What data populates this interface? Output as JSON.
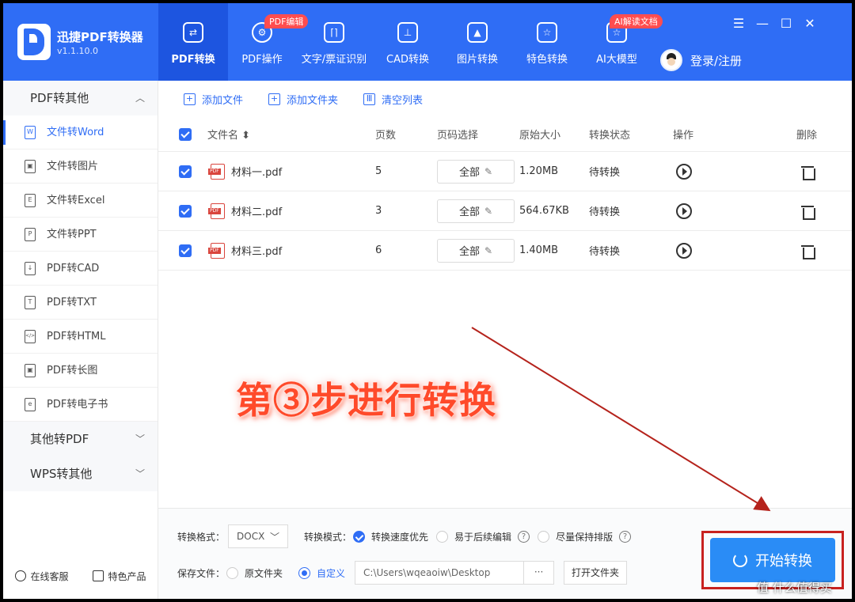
{
  "app": {
    "name": "迅捷PDF转换器",
    "version": "v1.1.10.0"
  },
  "nav": [
    {
      "label": "PDF转换",
      "icon": "convert-icon",
      "active": true,
      "badge": ""
    },
    {
      "label": "PDF操作",
      "icon": "gear-icon",
      "active": false,
      "badge": "PDF编辑"
    },
    {
      "label": "文字/票证识别",
      "icon": "scan-icon",
      "active": false,
      "badge": ""
    },
    {
      "label": "CAD转换",
      "icon": "cad-icon",
      "active": false,
      "badge": ""
    },
    {
      "label": "图片转换",
      "icon": "image-icon",
      "active": false,
      "badge": ""
    },
    {
      "label": "特色转换",
      "icon": "star-icon",
      "active": false,
      "badge": ""
    },
    {
      "label": "AI大模型",
      "icon": "ai-icon",
      "active": false,
      "badge": "AI解读文档"
    }
  ],
  "login_label": "登录/注册",
  "window_controls": [
    "☰",
    "—",
    "☐",
    "✕"
  ],
  "sidebar": {
    "group1": "PDF转其他",
    "items": [
      {
        "label": "文件转Word",
        "icon": "W",
        "active": true
      },
      {
        "label": "文件转图片",
        "icon": "▣",
        "active": false
      },
      {
        "label": "文件转Excel",
        "icon": "E",
        "active": false
      },
      {
        "label": "文件转PPT",
        "icon": "P",
        "active": false
      },
      {
        "label": "PDF转CAD",
        "icon": "↓",
        "active": false
      },
      {
        "label": "PDF转TXT",
        "icon": "T",
        "active": false
      },
      {
        "label": "PDF转HTML",
        "icon": "</>",
        "active": false
      },
      {
        "label": "PDF转长图",
        "icon": "▣",
        "active": false
      },
      {
        "label": "PDF转电子书",
        "icon": "e",
        "active": false
      }
    ],
    "group2": "其他转PDF",
    "group3": "WPS转其他",
    "footer": {
      "service": "在线客服",
      "products": "特色产品"
    }
  },
  "toolbar": {
    "add_file": "添加文件",
    "add_folder": "添加文件夹",
    "clear_list": "清空列表"
  },
  "table": {
    "headers": {
      "name": "文件名 ⬍",
      "pages": "页数",
      "page_select": "页码选择",
      "size": "原始大小",
      "status": "转换状态",
      "action": "操作",
      "delete": "删除"
    },
    "rows": [
      {
        "name": "材料一.pdf",
        "pages": "5",
        "select": "全部",
        "size": "1.20MB",
        "status": "待转换"
      },
      {
        "name": "材料二.pdf",
        "pages": "3",
        "select": "全部",
        "size": "564.67KB",
        "status": "待转换"
      },
      {
        "name": "材料三.pdf",
        "pages": "6",
        "select": "全部",
        "size": "1.40MB",
        "status": "待转换"
      }
    ]
  },
  "bottom": {
    "format_label": "转换格式：",
    "format_value": "DOCX",
    "mode_label": "转换模式：",
    "mode_options": [
      "转换速度优先",
      "易于后续编辑",
      "尽量保持排版"
    ],
    "save_label": "保存文件：",
    "save_options": [
      "原文件夹",
      "自定义"
    ],
    "path": "C:\\Users\\wqeaoiw\\Desktop",
    "path_button": "···",
    "open_folder": "打开文件夹",
    "start": "开始转换"
  },
  "annotation": "第③步进行转换",
  "watermark": "值 什么值得买",
  "colors": {
    "brand": "#2f6df5",
    "nav_active": "#1d55e0",
    "start": "#2a8cf6",
    "annotation": "#ff4a2a",
    "highlight_box": "#c8211f"
  }
}
